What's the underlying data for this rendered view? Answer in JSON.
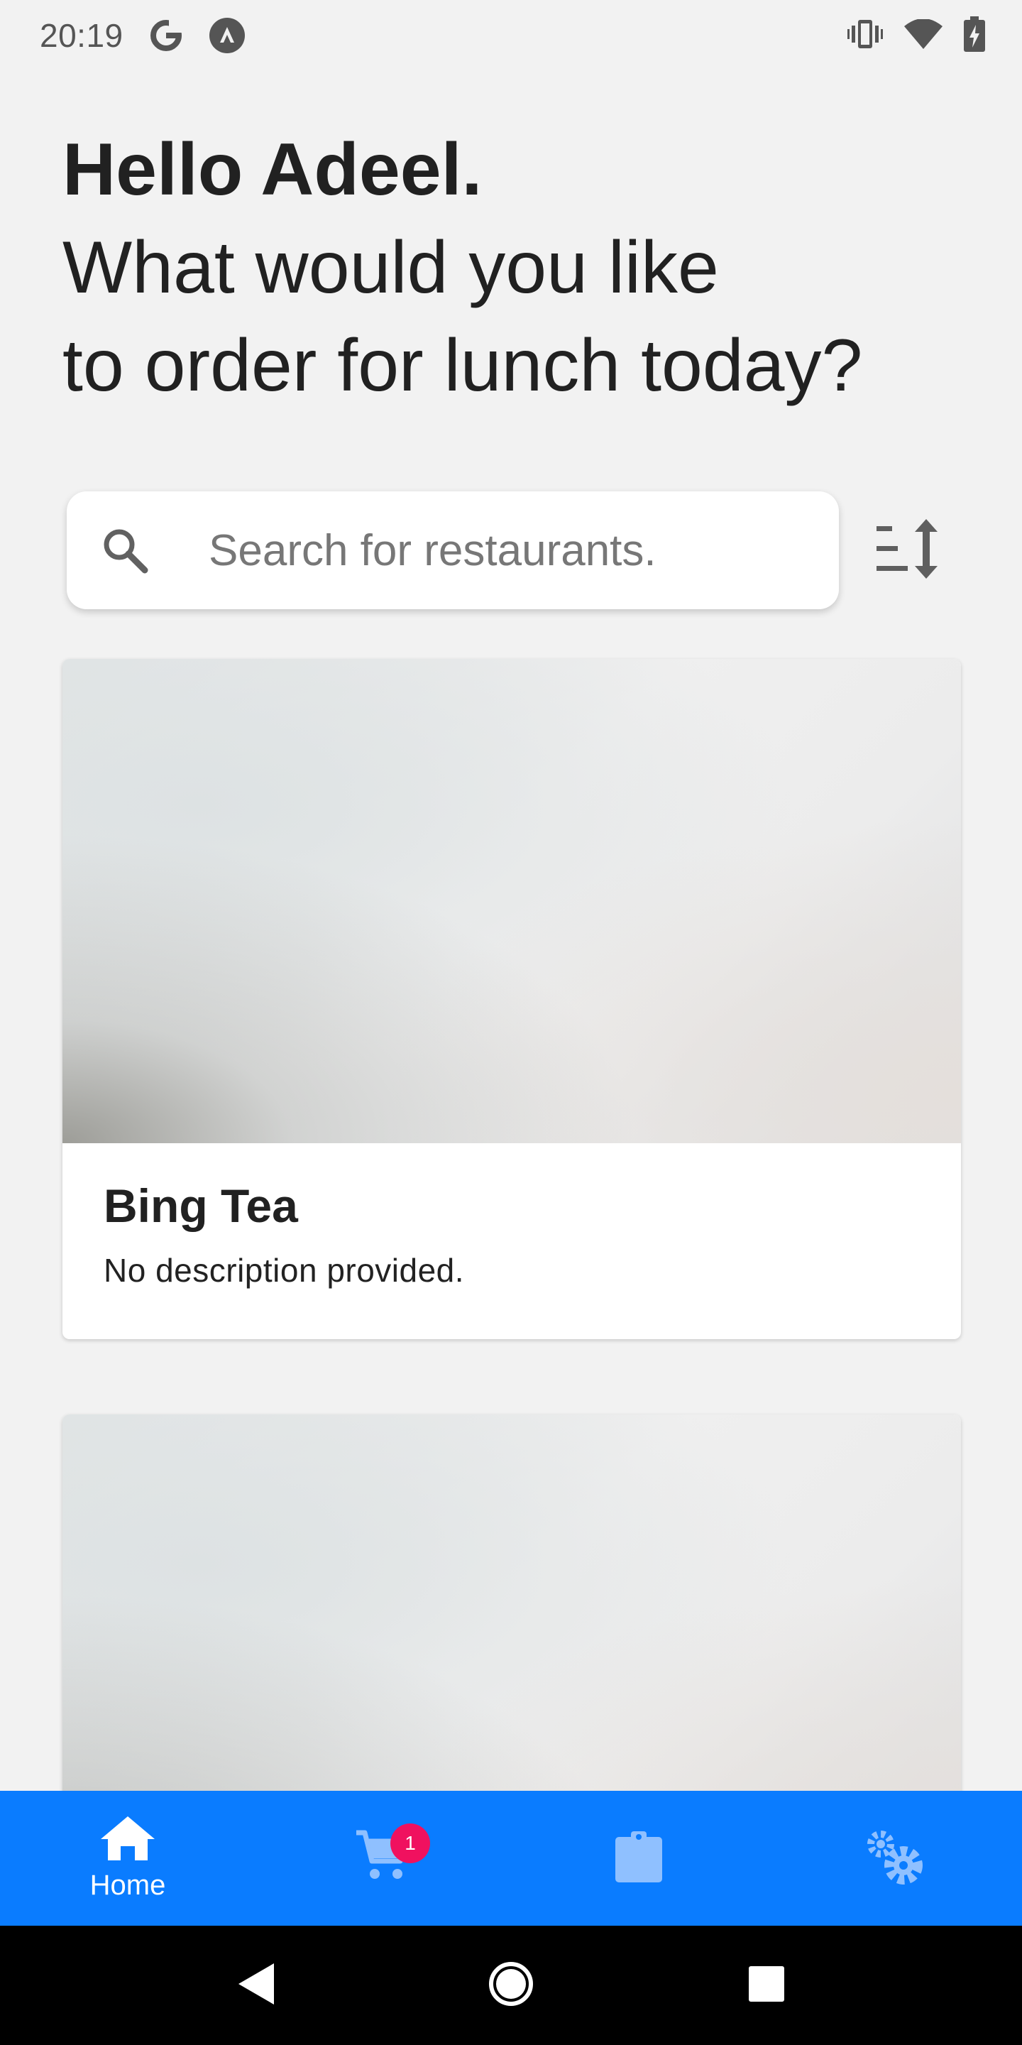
{
  "status_bar": {
    "time": "20:19",
    "left_icons": [
      "google-icon",
      "arrow-up-circle-icon"
    ],
    "right_icons": [
      "vibrate-icon",
      "wifi-icon",
      "battery-charging-icon"
    ]
  },
  "greeting": {
    "hello": "Hello Adeel.",
    "question_line1": "What would you like",
    "question_line2": "to order for lunch today?"
  },
  "search": {
    "placeholder": "Search for restaurants.",
    "value": ""
  },
  "restaurants": [
    {
      "name": "Bing Tea",
      "description": "No description provided."
    },
    {
      "name": "",
      "description": ""
    }
  ],
  "bottom_nav": {
    "items": [
      {
        "label": "Home",
        "icon": "home-icon",
        "active": true
      },
      {
        "label": "",
        "icon": "cart-icon",
        "badge": "1"
      },
      {
        "label": "",
        "icon": "clipboard-icon"
      },
      {
        "label": "",
        "icon": "settings-icon"
      }
    ]
  },
  "colors": {
    "accent": "#0a7cff",
    "badge": "#f0115f",
    "background": "#f2f2f2",
    "inactive_icon": "#8fc0ff"
  }
}
